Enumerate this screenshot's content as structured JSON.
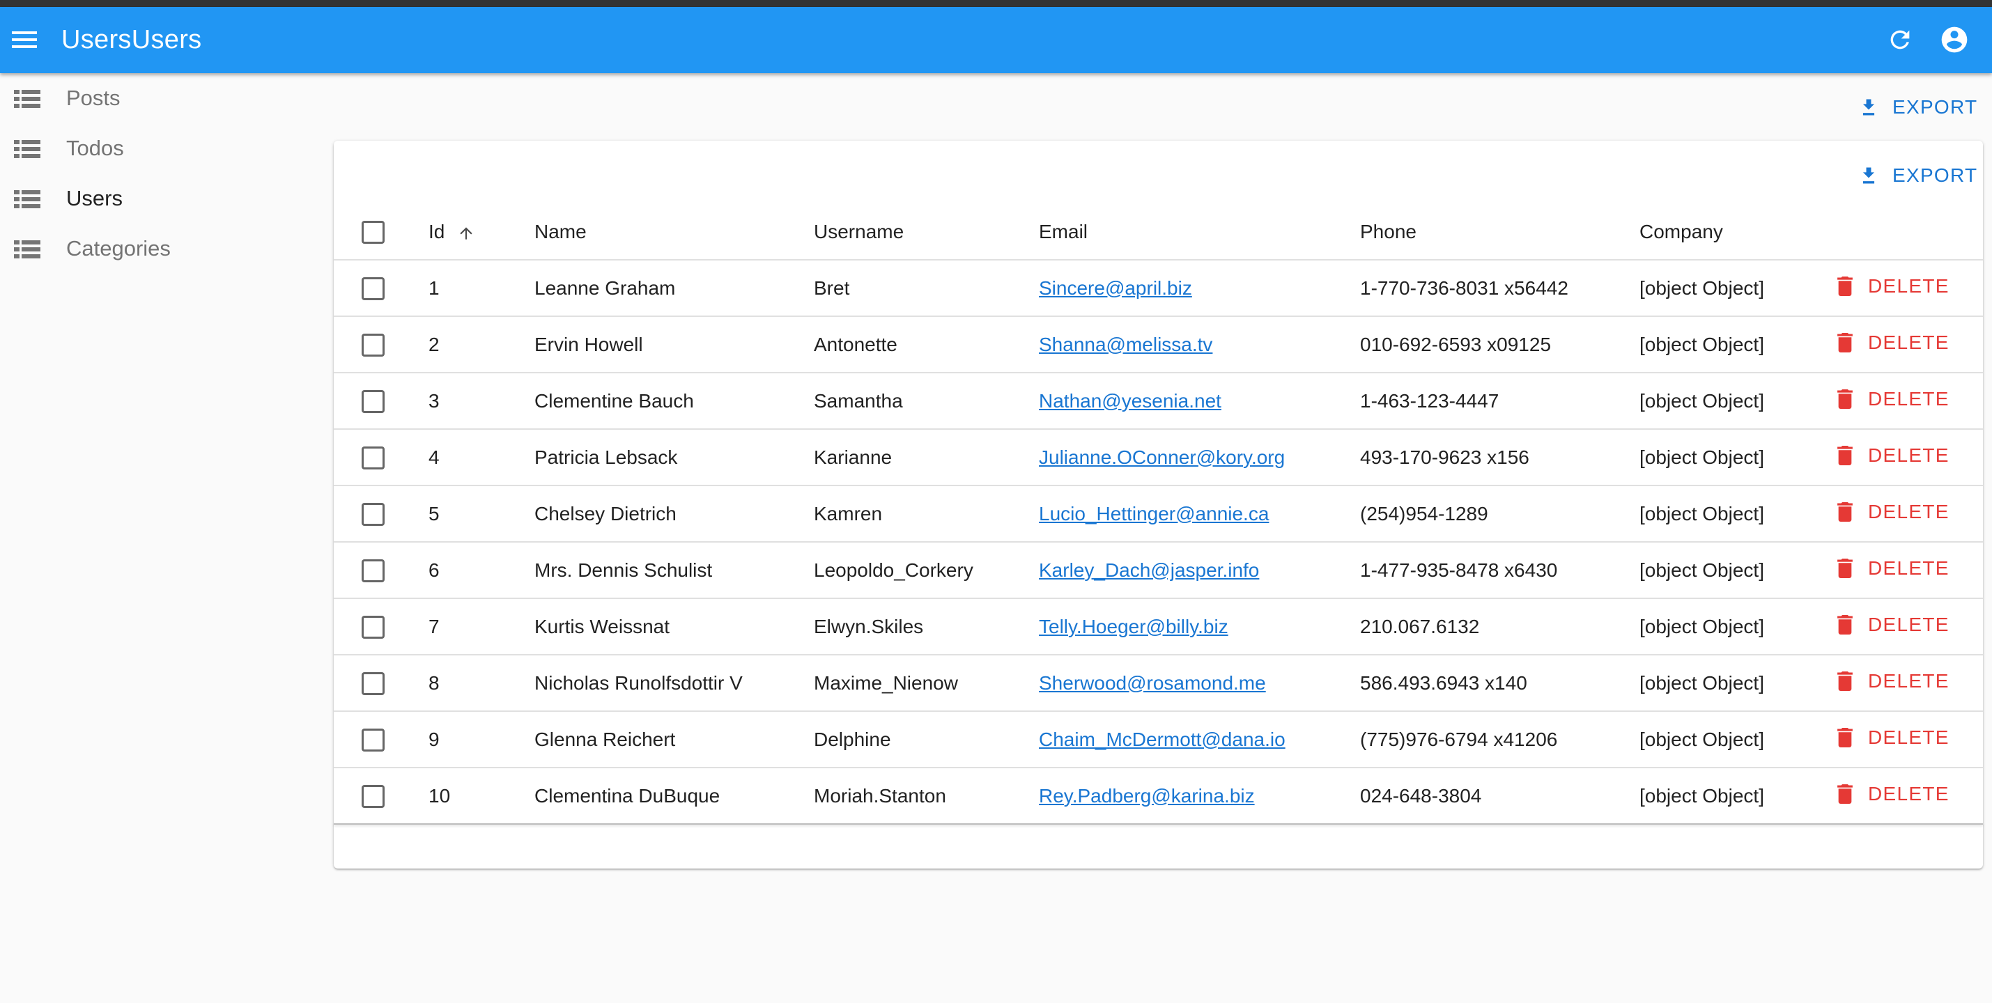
{
  "app": {
    "title": "UsersUsers"
  },
  "icons": {
    "menu": "menu-icon",
    "refresh": "refresh-icon",
    "account": "account-circle-icon",
    "list": "view-list-icon",
    "download": "download-icon",
    "sort": "arrow-up-icon",
    "delete": "trash-icon"
  },
  "colors": {
    "appbar": "#2196f3",
    "primary": "#1976d2",
    "danger": "#e53935"
  },
  "sidebar": {
    "items": [
      {
        "label": "Posts",
        "active": false
      },
      {
        "label": "Todos",
        "active": false
      },
      {
        "label": "Users",
        "active": true
      },
      {
        "label": "Categories",
        "active": false
      }
    ]
  },
  "toolbar": {
    "export_label": "EXPORT"
  },
  "list": {
    "export_label": "EXPORT"
  },
  "table": {
    "headers": {
      "id": "Id",
      "name": "Name",
      "username": "Username",
      "email": "Email",
      "phone": "Phone",
      "company": "Company"
    },
    "sort": {
      "column": "Id",
      "direction": "ascending"
    },
    "delete_label": "DELETE",
    "rows": [
      {
        "id": "1",
        "name": "Leanne Graham",
        "username": "Bret",
        "email": "Sincere@april.biz",
        "phone": "1-770-736-8031 x56442",
        "company": "[object Object]"
      },
      {
        "id": "2",
        "name": "Ervin Howell",
        "username": "Antonette",
        "email": "Shanna@melissa.tv",
        "phone": "010-692-6593 x09125",
        "company": "[object Object]"
      },
      {
        "id": "3",
        "name": "Clementine Bauch",
        "username": "Samantha",
        "email": "Nathan@yesenia.net",
        "phone": "1-463-123-4447",
        "company": "[object Object]"
      },
      {
        "id": "4",
        "name": "Patricia Lebsack",
        "username": "Karianne",
        "email": "Julianne.OConner@kory.org",
        "phone": "493-170-9623 x156",
        "company": "[object Object]"
      },
      {
        "id": "5",
        "name": "Chelsey Dietrich",
        "username": "Kamren",
        "email": "Lucio_Hettinger@annie.ca",
        "phone": "(254)954-1289",
        "company": "[object Object]"
      },
      {
        "id": "6",
        "name": "Mrs. Dennis Schulist",
        "username": "Leopoldo_Corkery",
        "email": "Karley_Dach@jasper.info",
        "phone": "1-477-935-8478 x6430",
        "company": "[object Object]"
      },
      {
        "id": "7",
        "name": "Kurtis Weissnat",
        "username": "Elwyn.Skiles",
        "email": "Telly.Hoeger@billy.biz",
        "phone": "210.067.6132",
        "company": "[object Object]"
      },
      {
        "id": "8",
        "name": "Nicholas Runolfsdottir V",
        "username": "Maxime_Nienow",
        "email": "Sherwood@rosamond.me",
        "phone": "586.493.6943 x140",
        "company": "[object Object]"
      },
      {
        "id": "9",
        "name": "Glenna Reichert",
        "username": "Delphine",
        "email": "Chaim_McDermott@dana.io",
        "phone": "(775)976-6794 x41206",
        "company": "[object Object]"
      },
      {
        "id": "10",
        "name": "Clementina DuBuque",
        "username": "Moriah.Stanton",
        "email": "Rey.Padberg@karina.biz",
        "phone": "024-648-3804",
        "company": "[object Object]"
      }
    ]
  }
}
